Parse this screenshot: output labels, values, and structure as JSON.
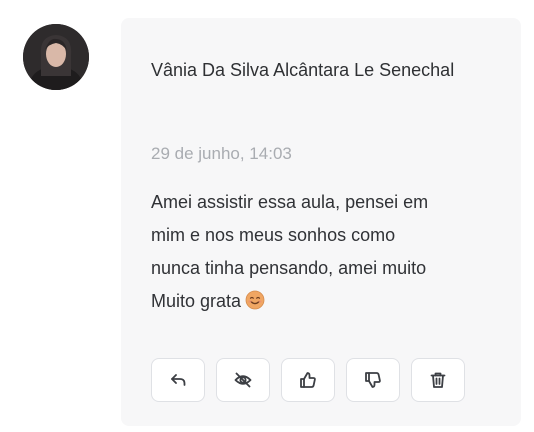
{
  "comment": {
    "author": "Vânia Da Silva Alcântara Le Senechal",
    "timestamp": "29 de junho, 14:03",
    "body_lines": [
      "Amei assistir essa aula, pensei em",
      "mim e nos meus sonhos como",
      "nunca tinha pensando, amei muito",
      "Muito grata"
    ],
    "emoji": "smiling-face-emoji",
    "avatar_icon": "user-photo-avatar"
  },
  "actions": [
    {
      "name": "reply",
      "icon": "reply-arrow-icon"
    },
    {
      "name": "hide",
      "icon": "eye-off-icon"
    },
    {
      "name": "like",
      "icon": "thumbs-up-icon"
    },
    {
      "name": "dislike",
      "icon": "thumbs-down-icon"
    },
    {
      "name": "delete",
      "icon": "trash-icon"
    }
  ],
  "colors": {
    "card_background": "#f7f7f8",
    "text": "#303236",
    "muted_text": "#a9acb1",
    "button_border": "#dfe1e5"
  }
}
